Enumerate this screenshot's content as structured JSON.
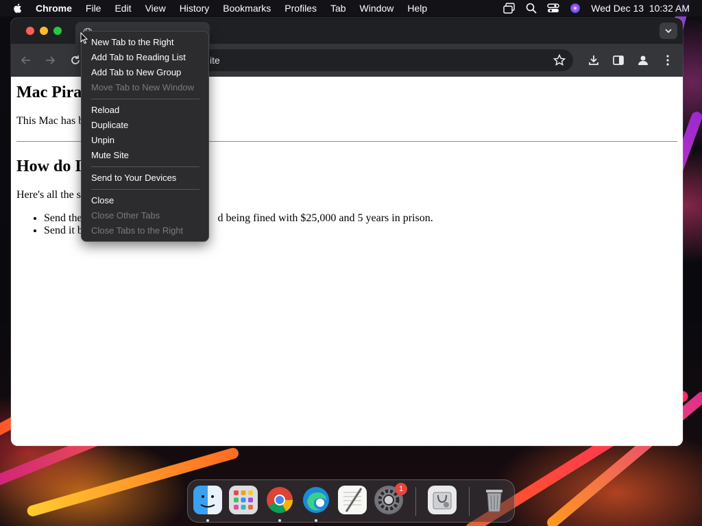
{
  "menubar": {
    "app": "Chrome",
    "items": [
      "File",
      "Edit",
      "View",
      "History",
      "Bookmarks",
      "Profiles",
      "Tab",
      "Window",
      "Help"
    ],
    "clock": "Wed Dec 13  10:32 AM"
  },
  "browser": {
    "tab_title": "",
    "url": "ite"
  },
  "page": {
    "heading1": "Mac Pira",
    "para1": "This Mac has b",
    "heading2": "How do I",
    "para2": "Here's all the s",
    "bullets": [
      "Send the",
      "d being fined with $25,000 and 5 years in prison.",
      "Send it b"
    ]
  },
  "context_menu": {
    "groups": [
      [
        {
          "label": "New Tab to the Right",
          "enabled": true
        },
        {
          "label": "Add Tab to Reading List",
          "enabled": true
        },
        {
          "label": "Add Tab to New Group",
          "enabled": true
        },
        {
          "label": "Move Tab to New Window",
          "enabled": false
        }
      ],
      [
        {
          "label": "Reload",
          "enabled": true
        },
        {
          "label": "Duplicate",
          "enabled": true
        },
        {
          "label": "Unpin",
          "enabled": true
        },
        {
          "label": "Mute Site",
          "enabled": true
        }
      ],
      [
        {
          "label": "Send to Your Devices",
          "enabled": true
        }
      ],
      [
        {
          "label": "Close",
          "enabled": true
        },
        {
          "label": "Close Other Tabs",
          "enabled": false
        },
        {
          "label": "Close Tabs to the Right",
          "enabled": false
        }
      ]
    ]
  },
  "dock": {
    "apps": [
      "finder-icon",
      "launchpad-icon",
      "chrome-icon",
      "edge-icon",
      "textedit-icon",
      "system-settings-icon",
      "disk-utility-icon",
      "trash-icon"
    ],
    "settings_badge": "1"
  },
  "colors": {
    "menu_bg": "#2c2c2e",
    "toolbar_bg": "#35363a",
    "tabstrip_bg": "#1f2023",
    "disabled_text": "#7b7b7f"
  }
}
